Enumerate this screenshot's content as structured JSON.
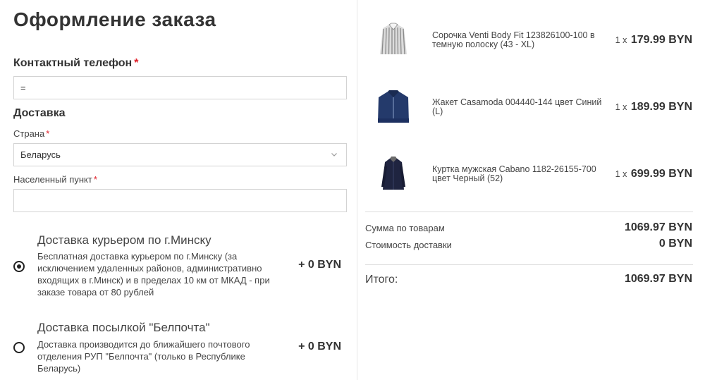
{
  "page_title": "Оформление заказа",
  "contact": {
    "label": "Контактный телефон",
    "required_mark": "*",
    "phone_value": "="
  },
  "delivery": {
    "heading": "Доставка",
    "country_label": "Страна",
    "country_value": "Беларусь",
    "city_label": "Населенный пункт",
    "city_value": "",
    "options": [
      {
        "title": "Доставка курьером по г.Минску",
        "description": "Бесплатная доставка курьером по г.Минску (за исключением удаленных районов, административно входящих в г.Минск) и в пределах 10 км от МКАД - при заказе товара от 80 рублей",
        "price": "+ 0 BYN",
        "selected": true
      },
      {
        "title": "Доставка посылкой \"Белпочта\"",
        "description": "Доставка производится до ближайшего почтового отделения РУП \"Белпочта\" (только в Республике Беларусь)",
        "price": "+ 0 BYN",
        "selected": false
      }
    ]
  },
  "cart": {
    "items": [
      {
        "name": "Сорочка Venti Body Fit 123826100-100 в темную полоску (43 - XL)",
        "qty": "1 x",
        "price": "179.99 BYN",
        "image": "striped-shirt"
      },
      {
        "name": "Жакет Casamoda 004440-144 цвет Синий (L)",
        "qty": "1 x",
        "price": "189.99 BYN",
        "image": "blue-jacket"
      },
      {
        "name": "Куртка мужская Cabano 1182-26155-700 цвет Черный (52)",
        "qty": "1 x",
        "price": "699.99 BYN",
        "image": "black-coat"
      }
    ],
    "subtotal_label": "Сумма по товарам",
    "subtotal_value": "1069.97 BYN",
    "shipping_label": "Стоимость доставки",
    "shipping_value": "0 BYN",
    "total_label": "Итого:",
    "total_value": "1069.97 BYN"
  },
  "colors": {
    "required": "#e0202a",
    "text": "#333333",
    "border": "#d3d3d3"
  }
}
